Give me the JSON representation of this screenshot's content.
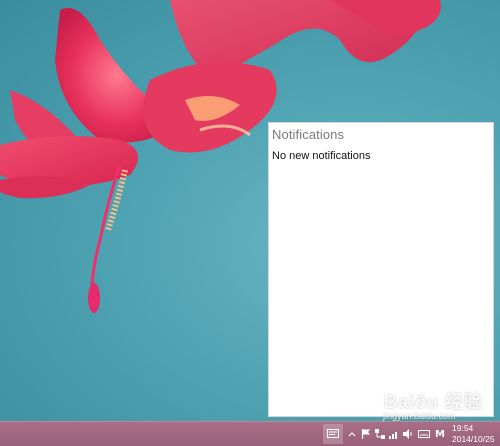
{
  "notifications": {
    "title": "Notifications",
    "empty_message": "No new notifications"
  },
  "taskbar": {
    "tray_icons": [
      "action-center-icon",
      "show-hidden-icons-arrow",
      "flag-icon",
      "network-icon",
      "volume-icon",
      "input-method-icon",
      "keyboard-icon"
    ],
    "input_method_label": "M",
    "clock_time": "19:54",
    "clock_date": "2014/10/25"
  },
  "watermark": {
    "text": "Baiðu 经验",
    "url": "jingyan.baidu.com"
  },
  "colors": {
    "wallpaper_bg": "#4fa3b2",
    "flower": "#e8315b",
    "taskbar": "#9a6079",
    "panel_bg": "#ffffff"
  }
}
